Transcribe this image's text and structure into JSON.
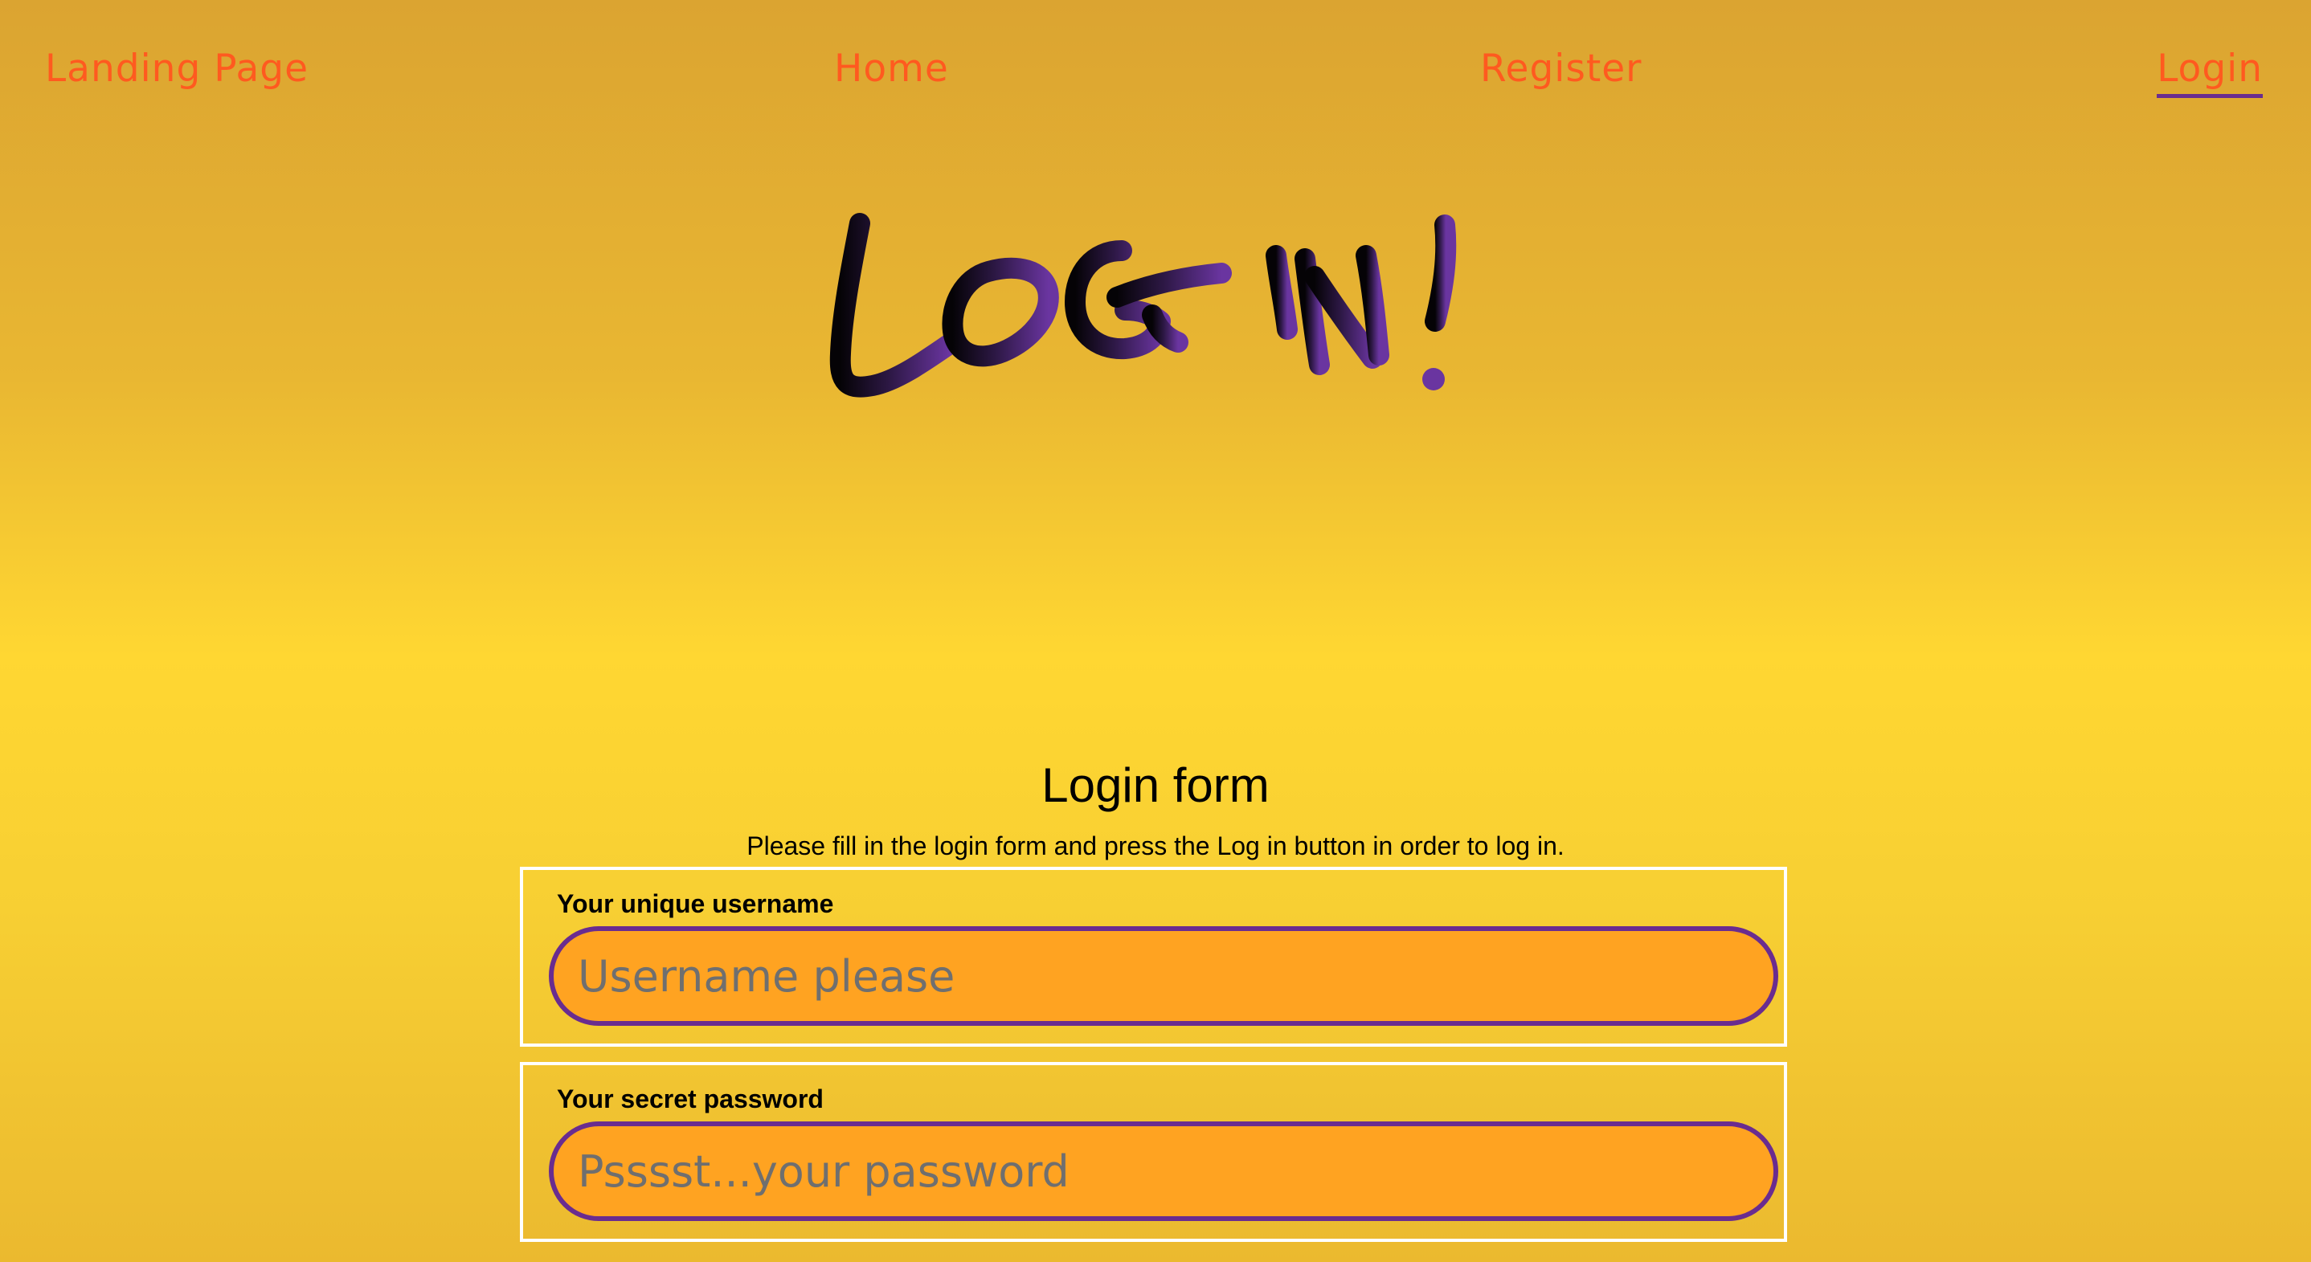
{
  "nav": {
    "landing_label": "Landing Page",
    "home_label": "Home",
    "register_label": "Register",
    "login_label": "Login",
    "active": "Login",
    "colors": {
      "link": "#ff5a1f",
      "active_underline": "#6a2c8f"
    }
  },
  "hero": {
    "title_art": "LOG IN!"
  },
  "form": {
    "title": "Login form",
    "subtitle": "Please fill in the login form and press the Log in button in order to log in.",
    "username": {
      "label": "Your unique username",
      "placeholder": "Username please",
      "value": ""
    },
    "password": {
      "label": "Your secret password",
      "placeholder": "Psssst...your password",
      "value": ""
    },
    "colors": {
      "input_fill": "#ffa321",
      "input_border": "#6a2c8f",
      "box_border": "#ffffff"
    }
  }
}
